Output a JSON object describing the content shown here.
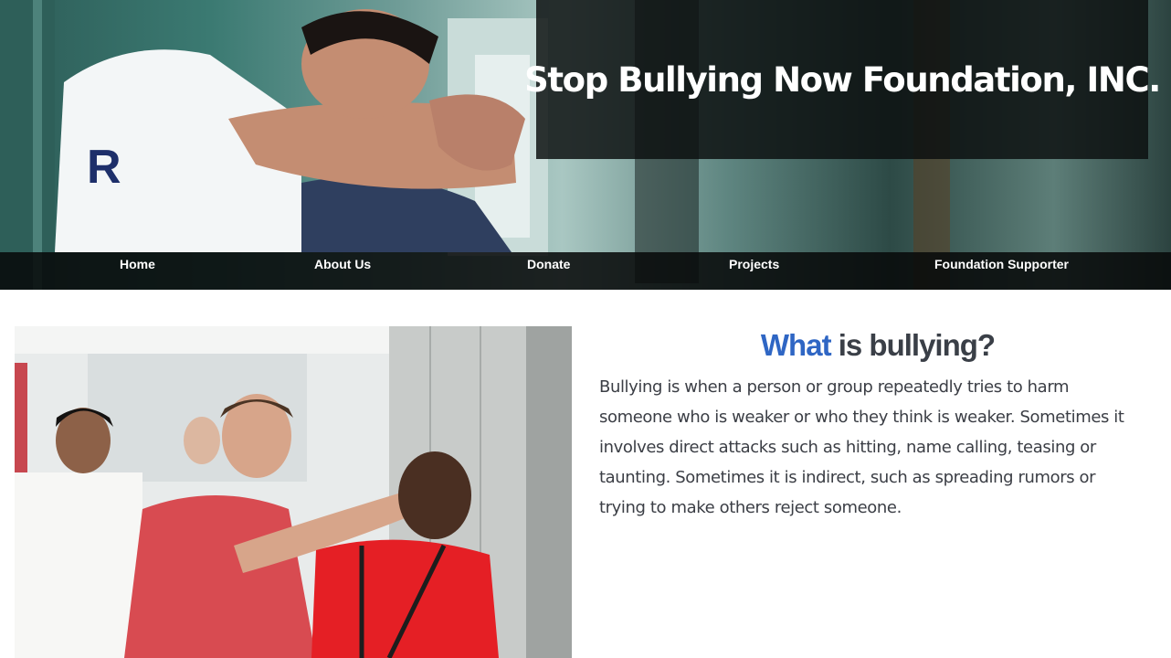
{
  "header": {
    "title": "Stop Bullying Now Foundation, INC."
  },
  "nav": {
    "home": "Home",
    "about": "About Us",
    "donate": "Donate",
    "projects": "Projects",
    "supporter": "Foundation Supporter"
  },
  "section": {
    "heading_accent": "What",
    "heading_rest": " is bullying?",
    "body": "Bullying is when a person or group repeatedly tries to harm someone who is weaker or who they think is weaker. Sometimes it involves direct attacks such as hitting, name calling, teasing or taunting. Sometimes it is indirect, such as spreading rumors or trying to make others reject someone."
  },
  "colors": {
    "accent": "#2f66c4",
    "heading_text": "#3a3f47",
    "body_text": "#3b3e45",
    "nav_background": "#0a0c0c",
    "title_box_background": "#0c100f"
  }
}
